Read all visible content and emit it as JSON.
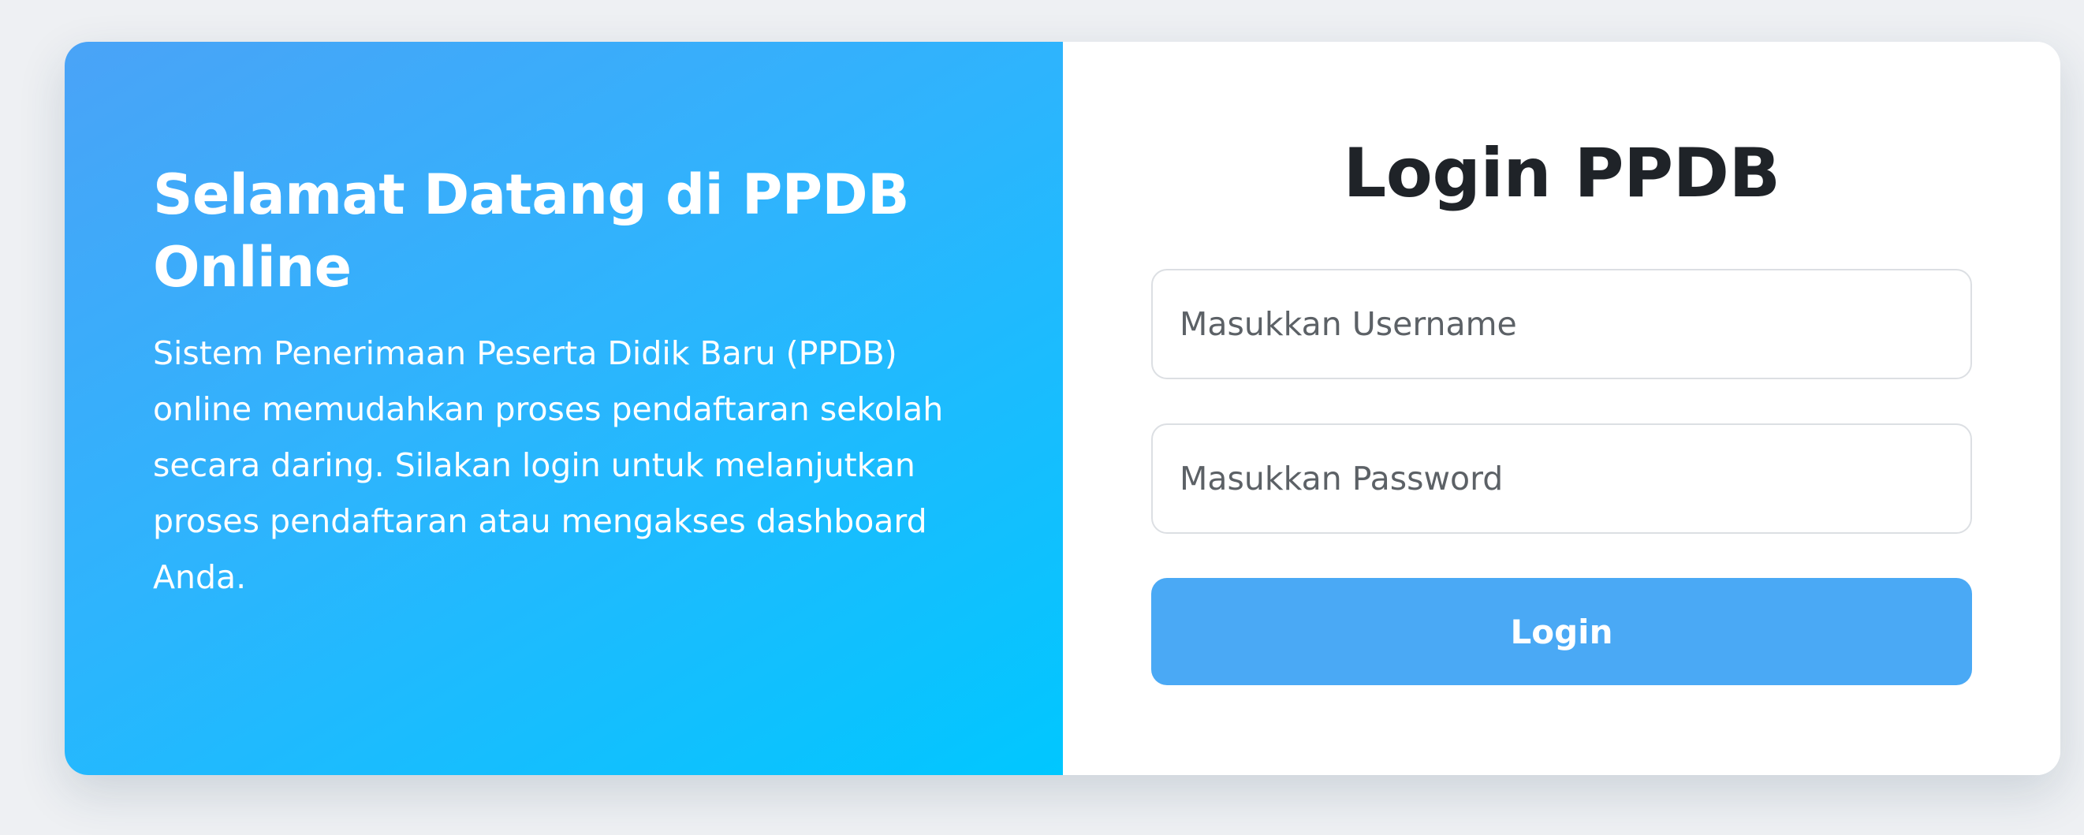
{
  "welcome": {
    "title": "Selamat Datang di PPDB Online",
    "description": "Sistem Penerimaan Peserta Didik Baru (PPDB) online memudahkan proses pendaftaran sekolah secara daring. Silakan login untuk melanjutkan proses pendaftaran atau mengakses dashboard Anda."
  },
  "login": {
    "title": "Login PPDB",
    "username": {
      "placeholder": "Masukkan Username",
      "value": ""
    },
    "password": {
      "placeholder": "Masukkan Password",
      "value": ""
    },
    "button_label": "Login"
  },
  "colors": {
    "gradient_start": "#4aa3f7",
    "gradient_end": "#00c7ff",
    "button": "#4aa9f5",
    "page_background": "#eef0f3"
  }
}
